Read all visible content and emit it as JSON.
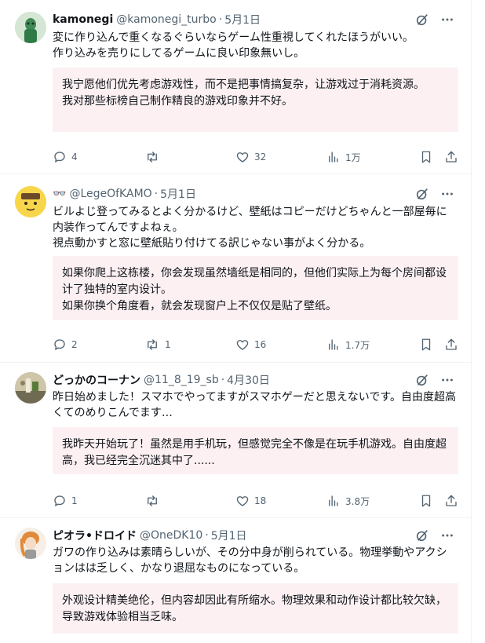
{
  "tweets": [
    {
      "name": "kamonegi",
      "handle": "@kamonegi_turbo",
      "separator": "·",
      "date": "5月1日",
      "text": "変に作り込んで重くなるぐらいならゲーム性重視してくれたほうがいい。\n作り込みを売りにしてるゲームに良い印象無いし。",
      "translation": "我宁愿他们优先考虑游戏性，而不是把事情搞复杂，让游戏过于消耗资源。\n我对那些标榜自己制作精良的游戏印象并不好。",
      "replies": "4",
      "retweets": "",
      "likes": "32",
      "views": "1万"
    },
    {
      "name": "👓",
      "handle": "@LegeOfKAMO",
      "separator": "·",
      "date": "5月1日",
      "text": "ビルよじ登ってみるとよく分かるけど、壁紙はコピーだけどちゃんと一部屋毎に内装作ってんですよねぇ。\n視点動かすと窓に壁紙貼り付けてる訳じゃない事がよく分かる。",
      "translation": "如果你爬上这栋楼，你会发现虽然墙纸是相同的，但他们实际上为每个房间都设计了独特的室内设计。\n如果你换个角度看，就会发现窗户上不仅仅是贴了壁纸。",
      "replies": "2",
      "retweets": "1",
      "likes": "16",
      "views": "1.7万"
    },
    {
      "name": "どっかのコーナン",
      "handle": "@11_8_19_sb",
      "separator": "·",
      "date": "4月30日",
      "text": "昨日始めました！スマホでやってますがスマホゲーだと思えないです。自由度超高くてのめりこんでます…",
      "translation": "我昨天开始玩了！虽然是用手机玩，但感觉完全不像是在玩手机游戏。自由度超高，我已经完全沉迷其中了......",
      "replies": "1",
      "retweets": "",
      "likes": "18",
      "views": "3.8万"
    },
    {
      "name": "ピオラ•ドロイド",
      "handle": "@OneDK10",
      "separator": "·",
      "date": "5月1日",
      "text": "ガワの作り込みは素晴らしいが、その分中身が削られている。物理挙動やアクションはは乏しく、かなり退屈なものになっている。",
      "translation": "外观设计精美绝伦，但内容却因此有所缩水。物理效果和动作设计都比较欠缺，导致游戏体验相当乏味。",
      "replies": "",
      "retweets": "",
      "likes": "",
      "views": ""
    }
  ],
  "colors": {
    "text": "#0f1419",
    "secondary": "#536471",
    "translation_bg": "#fcf0f2",
    "divider": "#eff3f4"
  },
  "icons": [
    "grok-icon",
    "more-icon",
    "reply-icon",
    "retweet-icon",
    "like-icon",
    "views-icon",
    "bookmark-icon",
    "share-icon"
  ]
}
